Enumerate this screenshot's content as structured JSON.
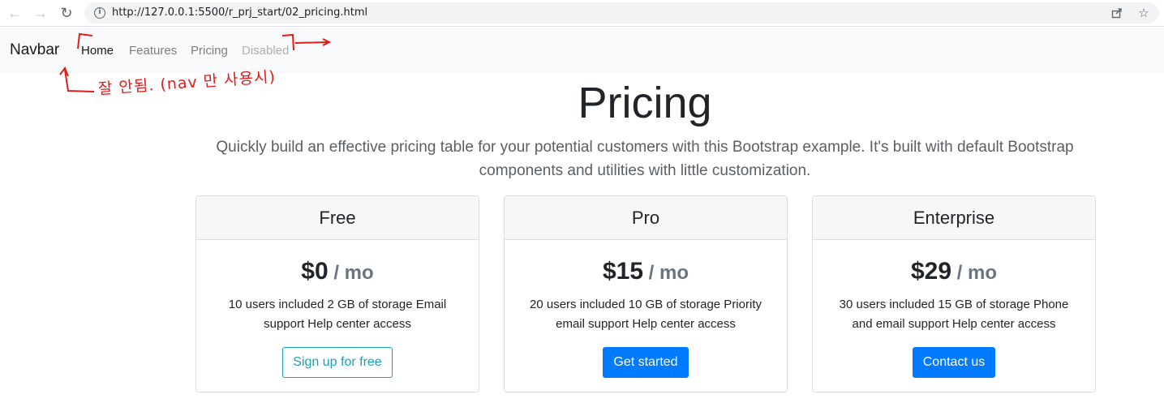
{
  "browser": {
    "url": "http://127.0.0.1:5500/r_prj_start/02_pricing.html"
  },
  "navbar": {
    "brand": "Navbar",
    "links": [
      {
        "label": "Home",
        "state": "active"
      },
      {
        "label": "Features",
        "state": "normal"
      },
      {
        "label": "Pricing",
        "state": "normal"
      },
      {
        "label": "Disabled",
        "state": "disabled"
      }
    ]
  },
  "annotation": {
    "text": "잘 안됨. (nav 만 사용시)",
    "color": "#e21b1b"
  },
  "hero": {
    "title": "Pricing",
    "lead": "Quickly build an effective pricing table for your potential customers with this Bootstrap example. It's built with default Bootstrap components and utilities with little customization."
  },
  "plans": [
    {
      "name": "Free",
      "price": "$0",
      "period": " / mo",
      "description": "10 users included 2 GB of storage Email support Help center access",
      "button": "Sign up for free",
      "button_style": "outline"
    },
    {
      "name": "Pro",
      "price": "$15",
      "period": " / mo",
      "description": "20 users included 10 GB of storage Priority email support Help center access",
      "button": "Get started",
      "button_style": "primary"
    },
    {
      "name": "Enterprise",
      "price": "$29",
      "period": " / mo",
      "description": "30 users included 15 GB of storage Phone and email support Help center access",
      "button": "Contact us",
      "button_style": "primary"
    }
  ],
  "colors": {
    "primary": "#007bff",
    "outline": "#17a2b8",
    "navbar_bg": "#f8f9fa"
  }
}
